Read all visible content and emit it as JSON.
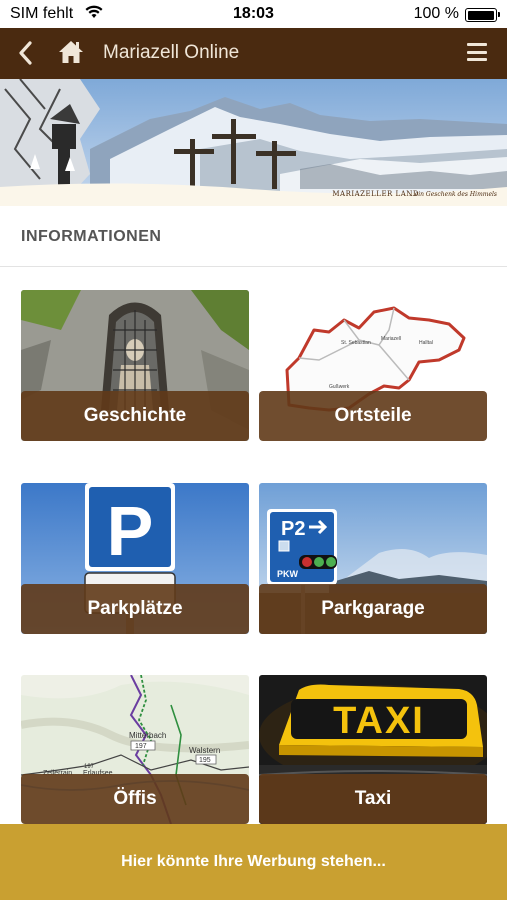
{
  "status_bar": {
    "carrier": "SIM fehlt",
    "time": "18:03",
    "battery_percent": "100 %",
    "battery_level": 1.0
  },
  "navbar": {
    "title": "Mariazell Online",
    "back_icon": "chevron-left-icon",
    "home_icon": "home-icon",
    "menu_icon": "hamburger-icon",
    "background": "#4a2a10"
  },
  "banner": {
    "brand": "MARIAZELLER LAND",
    "slogan": "...ein Geschenk des Himmels"
  },
  "section": {
    "title": "INFORMATIONEN"
  },
  "tiles": [
    {
      "label": "Geschichte"
    },
    {
      "label": "Ortsteile"
    },
    {
      "label": "Parkplätze"
    },
    {
      "label": "Parkgarage"
    },
    {
      "label": "Öffis"
    },
    {
      "label": "Taxi"
    }
  ],
  "ortsteile_map": {
    "place_1": "St. Sebastian",
    "place_2": "Mariazell",
    "place_3": "Halltal",
    "place_4": "Gußwerk"
  },
  "parkgarage_sign": {
    "p2": "P2",
    "pkw": "PKW"
  },
  "oeffis_map": {
    "place_1": "Mitterbach",
    "place_2": "Walstern",
    "place_3": "Erlaufsee",
    "place_4": "Zellerrain",
    "road_1": "197",
    "road_2": "195",
    "road_3": "197"
  },
  "taxi_sign": "TAXI",
  "ad": {
    "text": "Hier könnte Ihre Werbung stehen..."
  },
  "colors": {
    "brown_bar": "#4a2a10",
    "tile_label": "#603a18",
    "ad_gold": "#c9a031"
  }
}
